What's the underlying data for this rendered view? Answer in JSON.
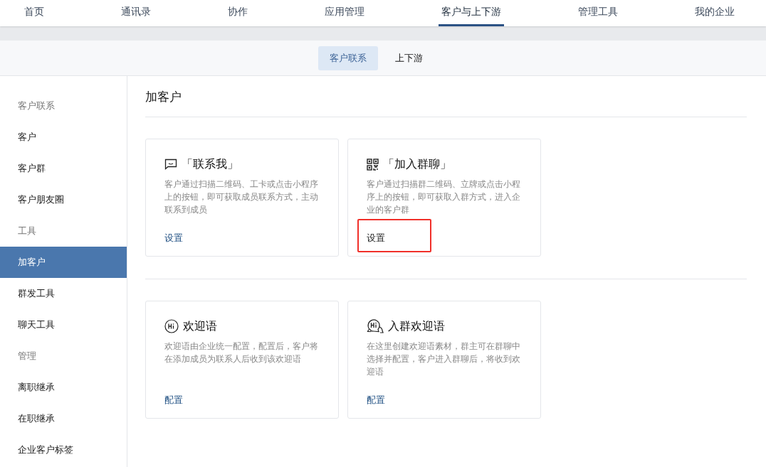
{
  "top_nav": [
    {
      "label": "首页",
      "selected": false
    },
    {
      "label": "通讯录",
      "selected": false
    },
    {
      "label": "协作",
      "selected": false
    },
    {
      "label": "应用管理",
      "selected": false
    },
    {
      "label": "客户与上下游",
      "selected": true
    },
    {
      "label": "管理工具",
      "selected": false
    },
    {
      "label": "我的企业",
      "selected": false
    }
  ],
  "sub_tabs": [
    {
      "label": "客户联系",
      "selected": true
    },
    {
      "label": "上下游",
      "selected": false
    }
  ],
  "sidebar": [
    {
      "kind": "heading",
      "label": "客户联系"
    },
    {
      "kind": "item",
      "label": "客户",
      "selected": false
    },
    {
      "kind": "item",
      "label": "客户群",
      "selected": false
    },
    {
      "kind": "item",
      "label": "客户朋友圈",
      "selected": false
    },
    {
      "kind": "heading",
      "label": "工具"
    },
    {
      "kind": "item",
      "label": "加客户",
      "selected": true
    },
    {
      "kind": "item",
      "label": "群发工具",
      "selected": false
    },
    {
      "kind": "item",
      "label": "聊天工具",
      "selected": false
    },
    {
      "kind": "heading",
      "label": "管理"
    },
    {
      "kind": "item",
      "label": "离职继承",
      "selected": false
    },
    {
      "kind": "item",
      "label": "在职继承",
      "selected": false
    },
    {
      "kind": "item",
      "label": "企业客户标签",
      "selected": false
    }
  ],
  "page_title": "加客户",
  "sections": [
    {
      "cards": [
        {
          "kind": "contact",
          "title": "「联系我」",
          "description": "客户通过扫描二维码、工卡或点击小程序上的按钮，即可获取成员联系方式，主动联系到成员",
          "action": "设置",
          "highlighted": false
        },
        {
          "kind": "group-join",
          "title": "「加入群聊」",
          "description": "客户通过扫描群二维码、立牌或点击小程序上的按钮，即可获取入群方式，进入企业的客户群",
          "action": "设置",
          "highlighted": true
        }
      ]
    },
    {
      "cards": [
        {
          "kind": "welcome",
          "title": "欢迎语",
          "description": "欢迎语由企业统一配置，配置后，客户将在添加成员为联系人后收到该欢迎语",
          "action": "配置",
          "highlighted": false
        },
        {
          "kind": "group-welcome",
          "title": "入群欢迎语",
          "description": "在这里创建欢迎语素材，群主可在群聊中选择并配置，客户进入群聊后，将收到欢迎语",
          "action": "配置",
          "highlighted": false
        }
      ]
    }
  ]
}
